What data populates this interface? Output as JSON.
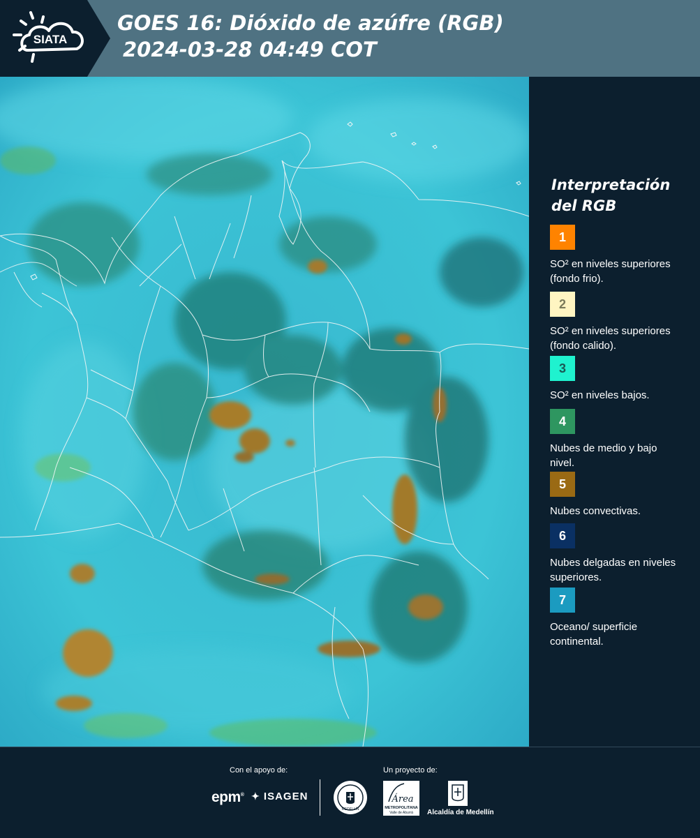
{
  "header": {
    "logo_text": "SIATA",
    "title_line1": "GOES 16: Dióxido de azúfre (RGB)",
    "title_line2": "2024-03-28 04:49 COT",
    "background_color": "#4f7282"
  },
  "legend": {
    "title": "Interpretación del RGB",
    "items": [
      {
        "number": "1",
        "color": "#ff8300",
        "text_color": "#ffffff",
        "description": "SO² en niveles superiores (fondo frio)."
      },
      {
        "number": "2",
        "color": "#fff5c2",
        "text_color": "#7a7a5a",
        "description": "SO² en niveles superiores (fondo calido)."
      },
      {
        "number": "3",
        "color": "#1ff2cf",
        "text_color": "#1a5a55",
        "description": "SO² en niveles bajos."
      },
      {
        "number": "4",
        "color": "#2e9660",
        "text_color": "#ffffff",
        "description": "Nubes de medio y bajo nivel."
      },
      {
        "number": "5",
        "color": "#9a6a14",
        "text_color": "#ffffff",
        "description": "Nubes convectivas."
      },
      {
        "number": "6",
        "color": "#0a3063",
        "text_color": "#ffffff",
        "description": "Nubes delgadas en niveles superiores."
      },
      {
        "number": "7",
        "color": "#1b9bc0",
        "text_color": "#ffffff",
        "description": "Oceano/ superficie continental."
      }
    ]
  },
  "footer": {
    "support_label": "Con el apoyo de:",
    "project_label": "Un proyecto de:",
    "epm": "epm",
    "isagen": "ISAGEN",
    "area_text": "Área",
    "area_subtext": "METROPOLITANA",
    "area_subtext2": "Valle de Aburrá",
    "seal_text": "MEDELLÍN",
    "alcaldia": "Alcaldía de Medellín"
  }
}
